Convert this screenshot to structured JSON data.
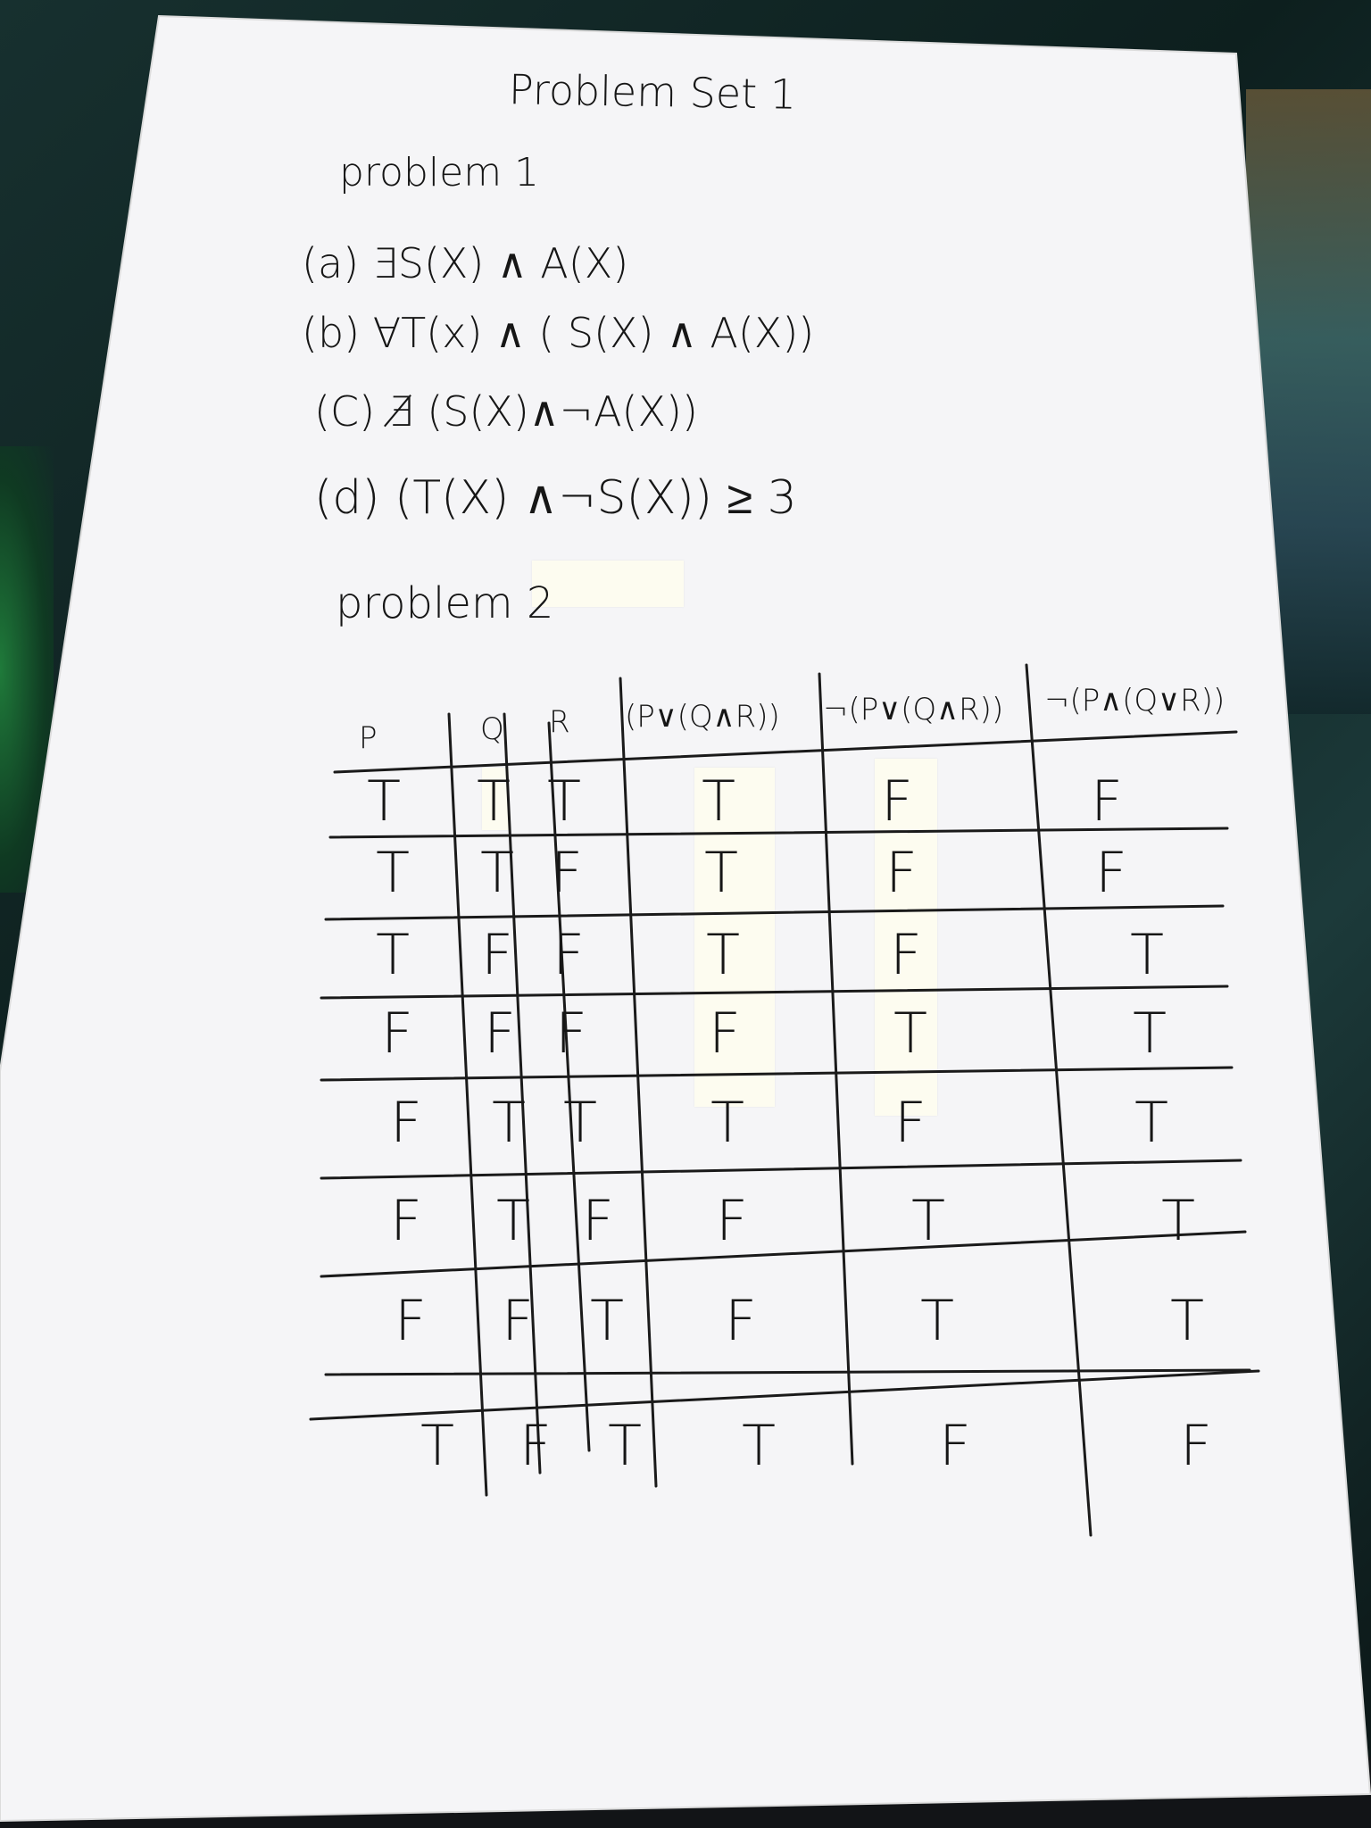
{
  "document": {
    "title": "Problem Set 1",
    "problem1": {
      "heading": "problem 1",
      "items": [
        "(a) ∃S(X) ∧ A(X)",
        "(b) ∀T(x) ∧ ( S(X) ∧ A(X))",
        "(C) ∄ (S(X)∧¬A(X))",
        "(d) (T(X) ∧¬S(X)) ≥ 3"
      ]
    },
    "problem2": {
      "heading": "problem 2",
      "truth_table": {
        "headers": [
          "P",
          "Q",
          "R",
          "(P∨(Q∧R))",
          "¬(P∨(Q∧R))",
          "¬(P∧(Q∨R))"
        ],
        "rows": [
          [
            "T",
            "T",
            "T",
            "T",
            "F",
            "F"
          ],
          [
            "T",
            "T",
            "F",
            "T",
            "F",
            "F"
          ],
          [
            "T",
            "F",
            "F",
            "T",
            "F",
            "T"
          ],
          [
            "F",
            "F",
            "F",
            "F",
            "T",
            "T"
          ],
          [
            "F",
            "T",
            "T",
            "T",
            "F",
            "T"
          ],
          [
            "F",
            "T",
            "F",
            "F",
            "T",
            "T"
          ],
          [
            "F",
            "F",
            "T",
            "F",
            "T",
            "T"
          ],
          [
            "T",
            "F",
            "T",
            "T",
            "F",
            "F"
          ]
        ]
      }
    }
  }
}
